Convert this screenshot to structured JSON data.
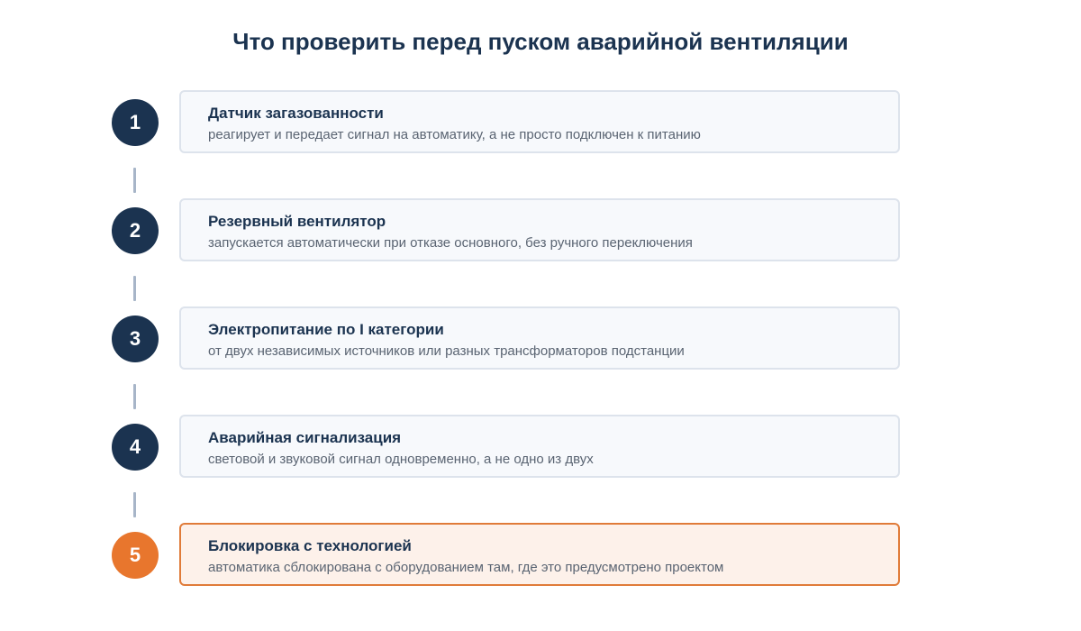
{
  "title": "Что проверить перед пуском аварийной вентиляции",
  "colors": {
    "primary": "#1b3350",
    "accent": "#e8762d",
    "card_bg": "#f7f9fc",
    "card_border": "#dde3ec",
    "accent_bg": "#fdf1ea",
    "accent_border": "#e07b39",
    "connector": "#a7b5c8"
  },
  "steps": [
    {
      "number": "1",
      "title": "Датчик загазованности",
      "description": "реагирует и передает сигнал на автоматику, а не просто подключен к питанию"
    },
    {
      "number": "2",
      "title": "Резервный вентилятор",
      "description": "запускается автоматически при отказе основного, без ручного переключения"
    },
    {
      "number": "3",
      "title": "Электропитание по I категории",
      "description": "от двух независимых источников или разных трансформаторов подстанции"
    },
    {
      "number": "4",
      "title": "Аварийная сигнализация",
      "description": "световой и звуковой сигнал одновременно, а не одно из двух"
    },
    {
      "number": "5",
      "title": "Блокировка с технологией",
      "description": "автоматика сблокирована с оборудованием там, где это предусмотрено проектом"
    }
  ]
}
